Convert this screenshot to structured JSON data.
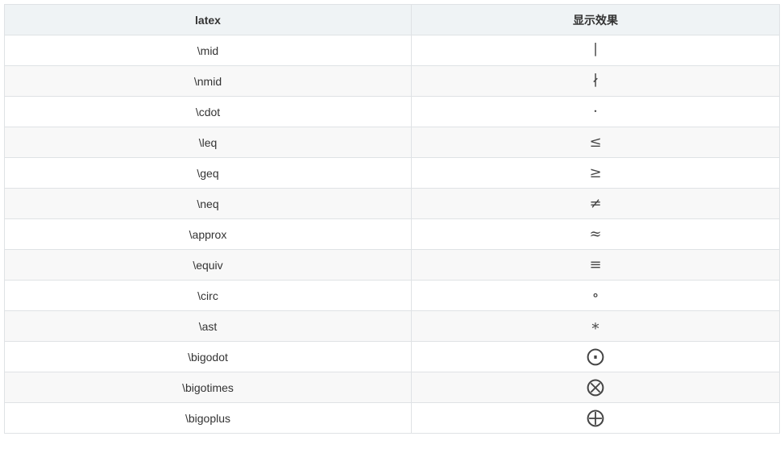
{
  "table": {
    "headers": {
      "latex": "latex",
      "display": "显示效果"
    },
    "rows": [
      {
        "latex": "\\mid",
        "display": "∣"
      },
      {
        "latex": "\\nmid",
        "display": "∤"
      },
      {
        "latex": "\\cdot",
        "display": "⋅"
      },
      {
        "latex": "\\leq",
        "display": "≤"
      },
      {
        "latex": "\\geq",
        "display": "≥"
      },
      {
        "latex": "\\neq",
        "display": "≠"
      },
      {
        "latex": "\\approx",
        "display": "≈"
      },
      {
        "latex": "\\equiv",
        "display": "≡"
      },
      {
        "latex": "\\circ",
        "display": "∘"
      },
      {
        "latex": "\\ast",
        "display": "∗"
      },
      {
        "latex": "\\bigodot",
        "display": "⨀"
      },
      {
        "latex": "\\bigotimes",
        "display": "⨂"
      },
      {
        "latex": "\\bigoplus",
        "display": "⨁"
      }
    ]
  }
}
